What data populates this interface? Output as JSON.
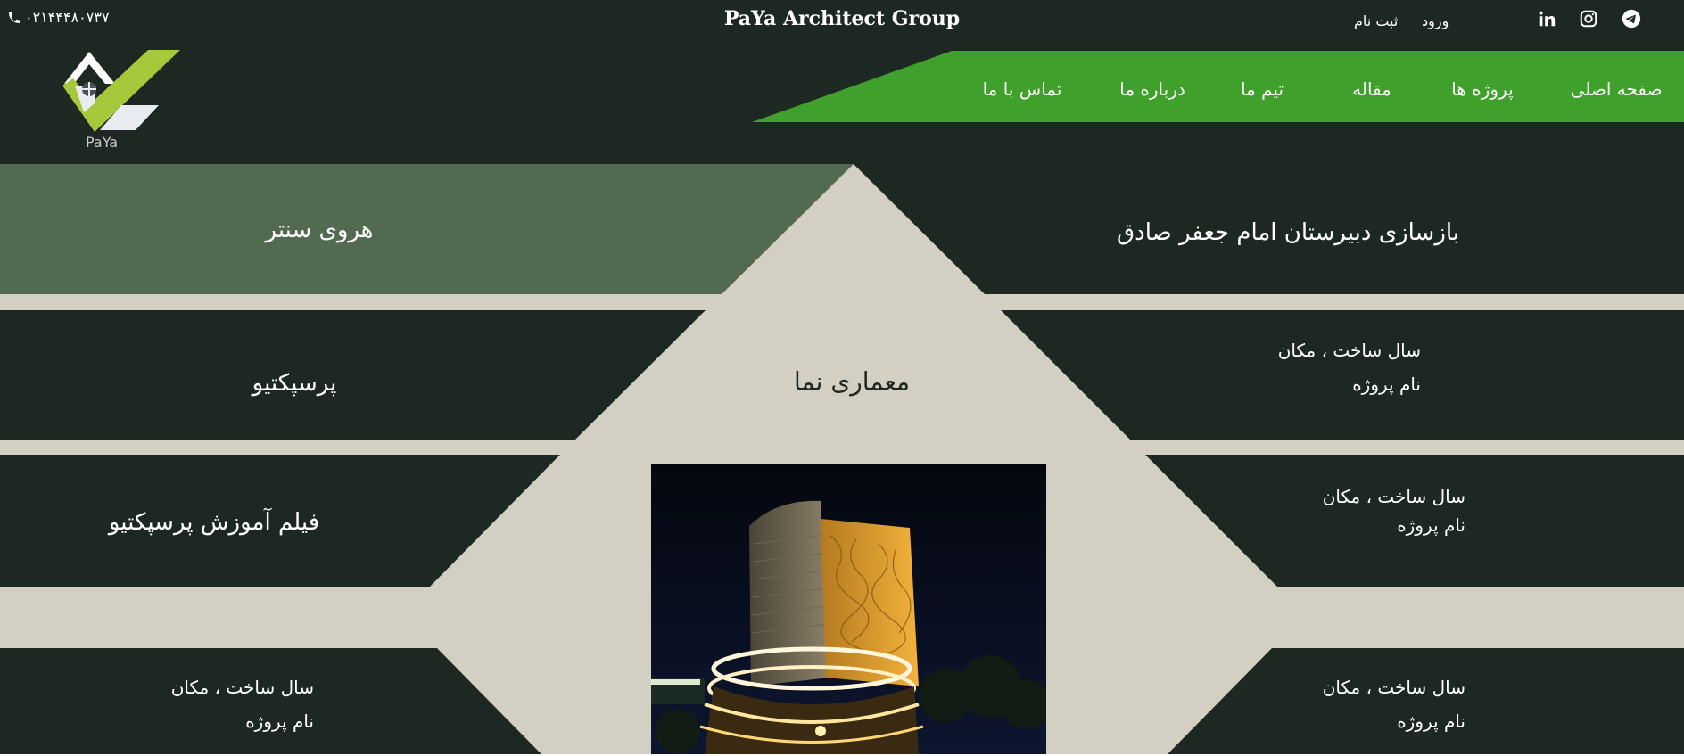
{
  "topbar": {
    "phone": "۰۲۱۴۴۴۸۰۷۳۷",
    "brand": "PaYa Architect Group",
    "login": "ورود",
    "signup": "ثبت نام",
    "social_icons": [
      "telegram-icon",
      "instagram-icon",
      "linkedin-icon"
    ]
  },
  "nav": {
    "items": [
      {
        "label": "صفحه اصلی"
      },
      {
        "label": "پروژه ها"
      },
      {
        "label": "مقاله"
      },
      {
        "label": "تیم ما"
      },
      {
        "label": "درباره ما"
      },
      {
        "label": "تماس با ما"
      }
    ],
    "accent": "#40a02c"
  },
  "logo": {
    "text": "PaYa"
  },
  "projects": {
    "row1_right": "بازسازی دبیرستان امام جعفر صادق",
    "row1_left": "هروی سنتر",
    "row2_left": "پرسپکتیو",
    "row3_left": "فیلم آموزش پرسپکتیو",
    "center_title": "معماری نما",
    "meta_year": "سال ساخت ، مکان",
    "meta_name": "نام پروژه"
  },
  "colors": {
    "background": "#1e2822",
    "beige": "#d4cfc3",
    "highlight": "#526a4f",
    "green": "#40a02c"
  }
}
